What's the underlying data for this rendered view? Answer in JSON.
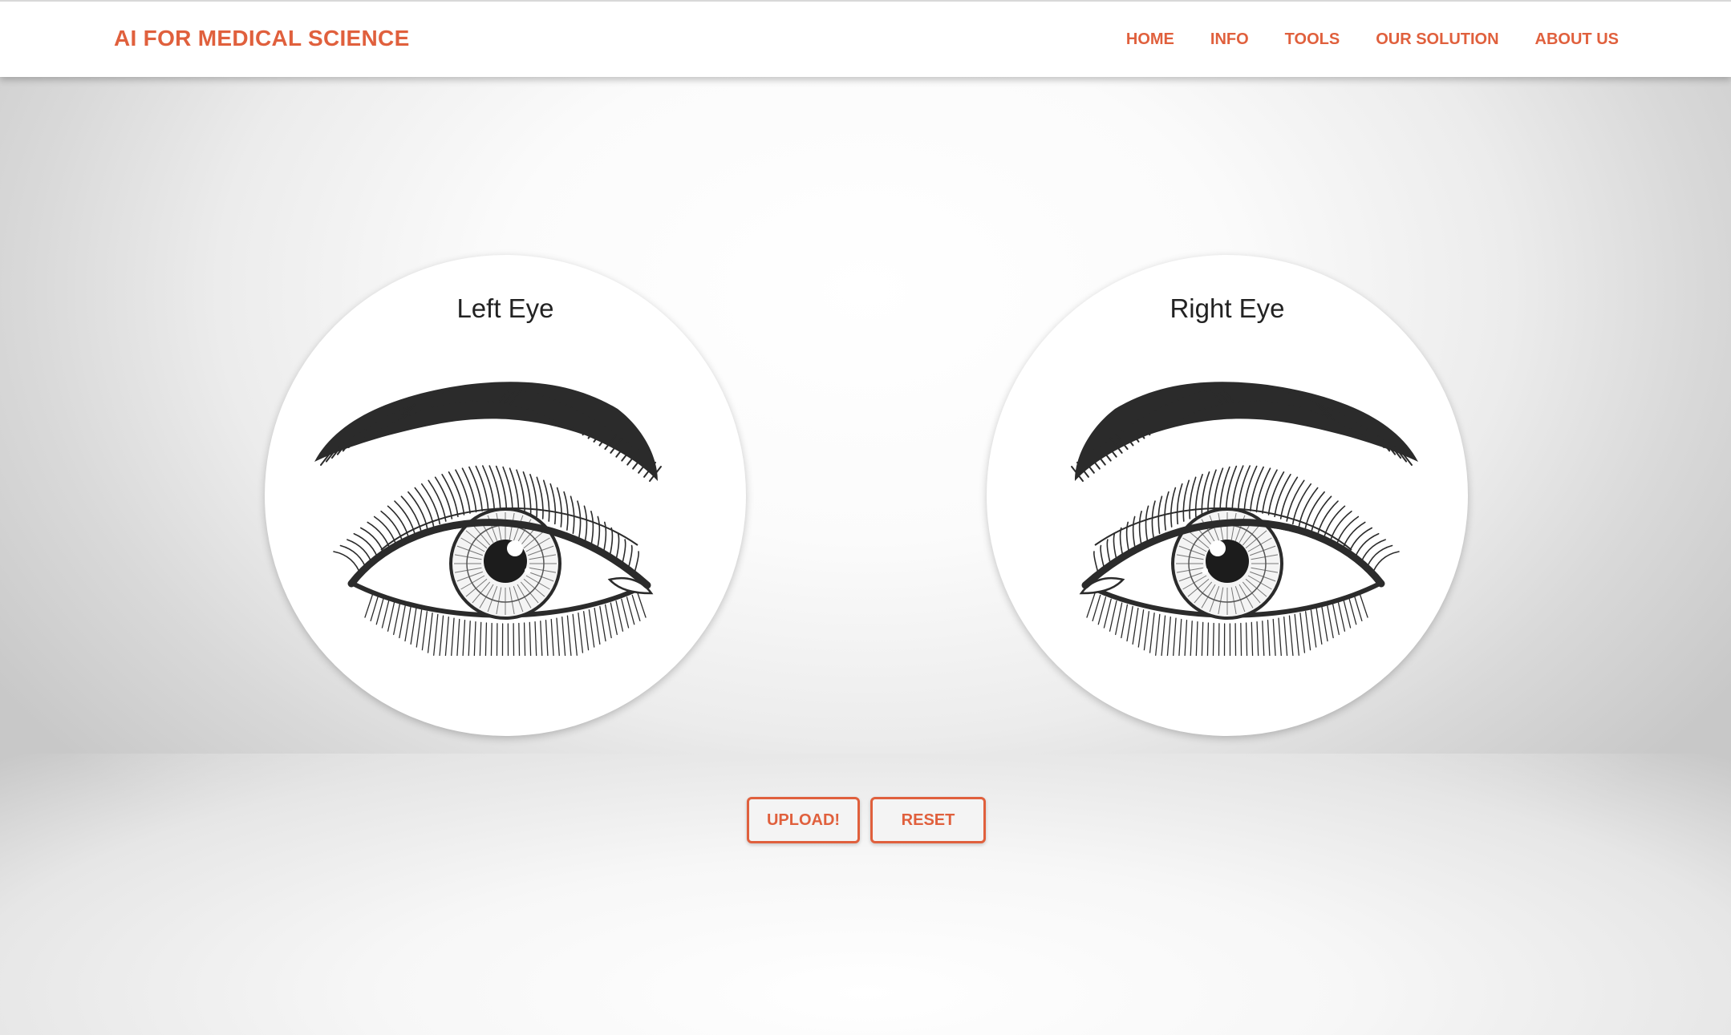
{
  "navbar": {
    "brand": "AI FOR MEDICAL SCIENCE",
    "links": [
      "HOME",
      "INFO",
      "TOOLS",
      "OUR SOLUTION",
      "ABOUT US"
    ]
  },
  "eyes": {
    "left": {
      "title": "Left Eye"
    },
    "right": {
      "title": "Right Eye"
    }
  },
  "actions": {
    "upload_label": "UPLOAD!",
    "reset_label": "RESET"
  },
  "colors": {
    "accent": "#e0603d",
    "ink": "#2b2b2b"
  }
}
